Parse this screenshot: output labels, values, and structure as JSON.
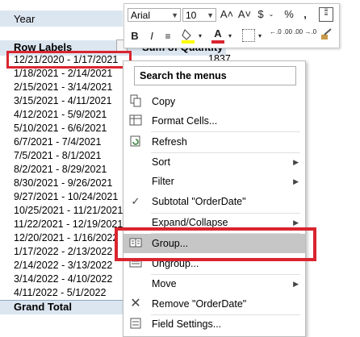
{
  "pivot": {
    "year_label": "Year",
    "row_labels_header": "Row Labels",
    "value_header": "Sum of Quantity",
    "first_value": "1837",
    "grand_total_label": "Grand Total",
    "rows": [
      "12/21/2020 - 1/17/2021",
      "1/18/2021 - 2/14/2021",
      "2/15/2021 - 3/14/2021",
      "3/15/2021 - 4/11/2021",
      "4/12/2021 - 5/9/2021",
      "5/10/2021 - 6/6/2021",
      "6/7/2021 - 7/4/2021",
      "7/5/2021 - 8/1/2021",
      "8/2/2021 - 8/29/2021",
      "8/30/2021 - 9/26/2021",
      "9/27/2021 - 10/24/2021",
      "10/25/2021 - 11/21/2021",
      "11/22/2021 - 12/19/2021",
      "12/20/2021 - 1/16/2022",
      "1/17/2022 - 2/13/2022",
      "2/14/2022 - 3/13/2022",
      "3/14/2022 - 4/10/2022",
      "4/11/2022 - 5/1/2022"
    ]
  },
  "mini_toolbar": {
    "font_name": "Arial",
    "font_size": "10",
    "grow_font": "A˄",
    "shrink_font": "A˅",
    "currency": "$",
    "percent": "%",
    "comma": ",",
    "bold": "B",
    "italic": "I",
    "font_color": "A",
    "increase_decimal": "←.0 .00",
    "decrease_decimal": ".00 →.0"
  },
  "menu": {
    "search_placeholder": "Search the menus",
    "items": {
      "copy": "Copy",
      "format_cells": "Format Cells...",
      "refresh": "Refresh",
      "sort": "Sort",
      "filter": "Filter",
      "subtotal": "Subtotal \"OrderDate\"",
      "expand_collapse": "Expand/Collapse",
      "group": "Group...",
      "ungroup": "Ungroup...",
      "move": "Move",
      "remove": "Remove \"OrderDate\"",
      "field_settings": "Field Settings..."
    }
  },
  "colors": {
    "highlight_red": "#d9252f",
    "pivot_header_bg": "#dce6f1",
    "menu_hover": "#c6c6c6"
  }
}
